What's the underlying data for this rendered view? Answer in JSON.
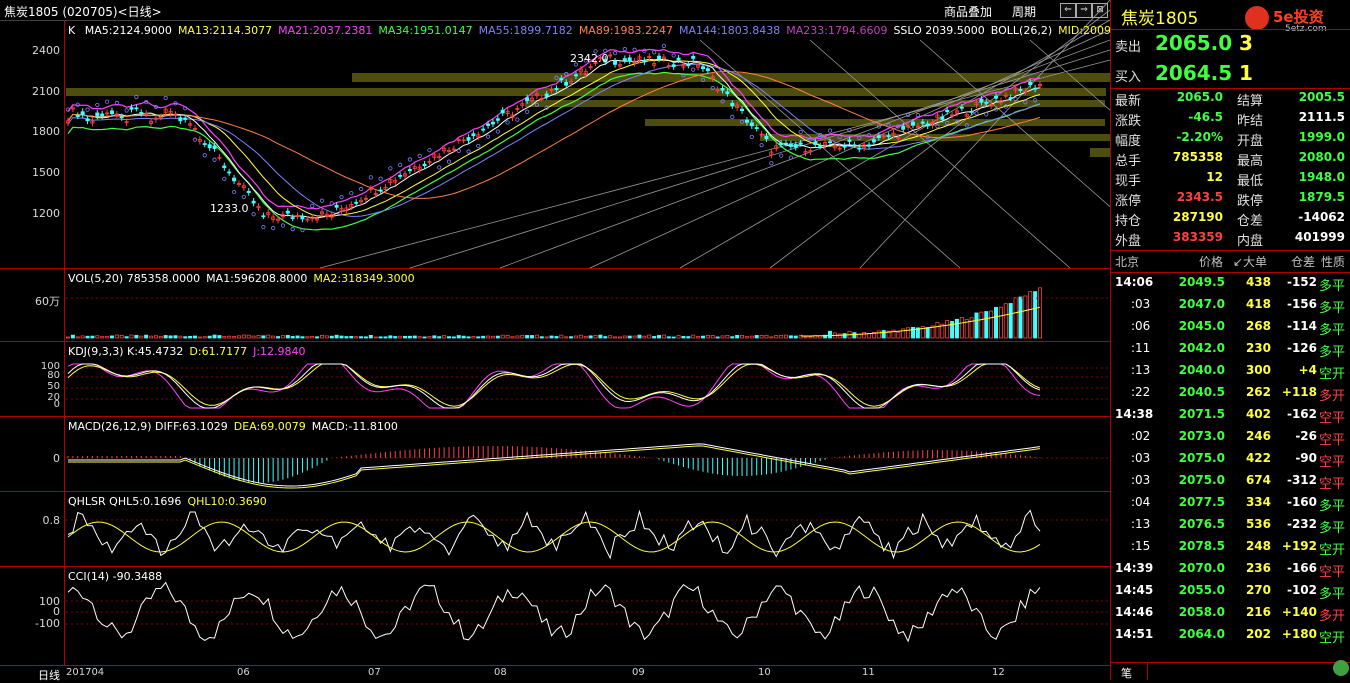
{
  "titlebar": {
    "title": "焦炭1805 (020705)<日线>",
    "btn_overlay": "商品叠加",
    "btn_period": "周期"
  },
  "main": {
    "k_label": "K",
    "ma": [
      {
        "text": "MA5:2124.9000",
        "color": "#ffffff"
      },
      {
        "text": "MA13:2114.3077",
        "color": "#ffff40"
      },
      {
        "text": "MA21:2037.2381",
        "color": "#ff40ff"
      },
      {
        "text": "MA34:1951.0147",
        "color": "#40ff40"
      },
      {
        "text": "MA55:1899.7182",
        "color": "#8080ff"
      },
      {
        "text": "MA89:1983.2247",
        "color": "#ff8040"
      },
      {
        "text": "MA144:1803.8438",
        "color": "#8080ff"
      },
      {
        "text": "MA233:1794.6609",
        "color": "#c040c0"
      },
      {
        "text": "SSLO 2039.5000",
        "color": "#ffffff"
      },
      {
        "text": "BOLL(26,2)",
        "color": "#ffffff"
      },
      {
        "text": "MID:2009",
        "color": "#ffff40"
      }
    ],
    "yticks": [
      "2400",
      "2100",
      "1800",
      "1500",
      "1200"
    ],
    "high_label": "2342.0",
    "low_label": "1233.0"
  },
  "vol": {
    "hdr": [
      {
        "text": "VOL(5,20) 785358.0000",
        "color": "#ffffff"
      },
      {
        "text": "MA1:596208.8000",
        "color": "#ffffff"
      },
      {
        "text": "MA2:318349.3000",
        "color": "#ffff40"
      }
    ],
    "ytick": "60万"
  },
  "kdj": {
    "hdr": [
      {
        "text": "KDJ(9,3,3) K:45.4732",
        "color": "#ffffff"
      },
      {
        "text": "D:61.7177",
        "color": "#ffff40"
      },
      {
        "text": "J:12.9840",
        "color": "#ff40ff"
      }
    ],
    "yticks": [
      "100",
      "80",
      "50",
      "20",
      "0"
    ]
  },
  "macd": {
    "hdr": [
      {
        "text": "MACD(26,12,9) DIFF:63.1029",
        "color": "#ffffff"
      },
      {
        "text": "DEA:69.0079",
        "color": "#ffff40"
      },
      {
        "text": "MACD:-11.8100",
        "color": "#ffffff"
      }
    ],
    "ytick": "0"
  },
  "qhlsr": {
    "hdr": [
      {
        "text": "QHLSR QHL5:0.1696",
        "color": "#ffffff"
      },
      {
        "text": "QHL10:0.3690",
        "color": "#ffff40"
      }
    ],
    "ytick": "0.8"
  },
  "cci": {
    "hdr": [
      {
        "text": "CCI(14) -90.3488",
        "color": "#ffffff"
      }
    ],
    "yticks": [
      "100",
      "0",
      "-100"
    ]
  },
  "xaxis": {
    "corner": "日线",
    "labels": [
      "201704",
      "06",
      "07",
      "08",
      "09",
      "10",
      "11",
      "12"
    ]
  },
  "right": {
    "title": "焦炭1805",
    "logo": "5e投资",
    "logo_url": "5etz.com",
    "sell_label": "卖出",
    "sell_price": "2065.0",
    "sell_vol": "3",
    "buy_label": "买入",
    "buy_price": "2064.5",
    "buy_vol": "1",
    "stats": [
      [
        "最新",
        "2065.0",
        "#40ff40",
        "结算",
        "2005.5",
        "#40ff40"
      ],
      [
        "涨跌",
        "-46.5",
        "#40ff40",
        "昨结",
        "2111.5",
        "#ffffff"
      ],
      [
        "幅度",
        "-2.20%",
        "#40ff40",
        "开盘",
        "1999.0",
        "#40ff40"
      ],
      [
        "总手",
        "785358",
        "#ffff40",
        "最高",
        "2080.0",
        "#40ff40"
      ],
      [
        "现手",
        "12",
        "#ffff40",
        "最低",
        "1948.0",
        "#40ff40"
      ],
      [
        "涨停",
        "2343.5",
        "#ff4040",
        "跌停",
        "1879.5",
        "#40ff40"
      ],
      [
        "持仓",
        "287190",
        "#ffff40",
        "仓差",
        "-14062",
        "#ffffff"
      ],
      [
        "外盘",
        "383359",
        "#ff4040",
        "内盘",
        "401999",
        "#ffffff"
      ]
    ],
    "tick_header": [
      "北京",
      "价格",
      "↙大单",
      "仓差",
      "性质"
    ],
    "ticks": [
      {
        "t": "14:06",
        "p": "2049.5",
        "v": "438",
        "d": "-152",
        "n": "多平",
        "nc": "#40ff40",
        "tb": true
      },
      {
        "t": ":03",
        "p": "2047.0",
        "v": "418",
        "d": "-156",
        "n": "多平",
        "nc": "#40ff40",
        "tb": false
      },
      {
        "t": ":06",
        "p": "2045.0",
        "v": "268",
        "d": "-114",
        "n": "多平",
        "nc": "#40ff40",
        "tb": false
      },
      {
        "t": ":11",
        "p": "2042.0",
        "v": "230",
        "d": "-126",
        "n": "多平",
        "nc": "#40ff40",
        "tb": false
      },
      {
        "t": ":13",
        "p": "2040.0",
        "v": "300",
        "d": "+4",
        "n": "空开",
        "nc": "#40ff40",
        "tb": false
      },
      {
        "t": ":22",
        "p": "2040.5",
        "v": "262",
        "d": "+118",
        "n": "多开",
        "nc": "#ff4040",
        "tb": false
      },
      {
        "t": "14:38",
        "p": "2071.5",
        "v": "402",
        "d": "-162",
        "n": "空平",
        "nc": "#ff4040",
        "tb": true
      },
      {
        "t": ":02",
        "p": "2073.0",
        "v": "246",
        "d": "-26",
        "n": "空平",
        "nc": "#ff4040",
        "tb": false
      },
      {
        "t": ":03",
        "p": "2075.0",
        "v": "422",
        "d": "-90",
        "n": "空平",
        "nc": "#ff4040",
        "tb": false
      },
      {
        "t": ":03",
        "p": "2075.0",
        "v": "674",
        "d": "-312",
        "n": "空平",
        "nc": "#ff4040",
        "tb": false
      },
      {
        "t": ":04",
        "p": "2077.5",
        "v": "334",
        "d": "-160",
        "n": "多平",
        "nc": "#40ff40",
        "tb": false
      },
      {
        "t": ":13",
        "p": "2076.5",
        "v": "536",
        "d": "-232",
        "n": "多平",
        "nc": "#40ff40",
        "tb": false
      },
      {
        "t": ":15",
        "p": "2078.5",
        "v": "248",
        "d": "+192",
        "n": "空开",
        "nc": "#40ff40",
        "tb": false
      },
      {
        "t": "14:39",
        "p": "2070.0",
        "v": "236",
        "d": "-166",
        "n": "空平",
        "nc": "#ff4040",
        "tb": true
      },
      {
        "t": "14:45",
        "p": "2055.0",
        "v": "270",
        "d": "-102",
        "n": "多平",
        "nc": "#40ff40",
        "tb": true
      },
      {
        "t": "14:46",
        "p": "2058.0",
        "v": "216",
        "d": "+140",
        "n": "多开",
        "nc": "#ff4040",
        "tb": true
      },
      {
        "t": "14:51",
        "p": "2064.0",
        "v": "202",
        "d": "+180",
        "n": "空开",
        "nc": "#40ff40",
        "tb": true
      }
    ],
    "footer": "笔"
  }
}
